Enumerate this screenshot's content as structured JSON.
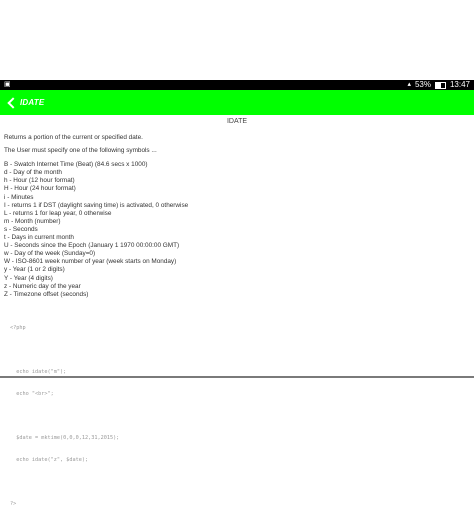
{
  "status_bar": {
    "left_icon": "image-icon",
    "battery_pct": "53%",
    "time": "13:47"
  },
  "app_bar": {
    "title": "IDATE",
    "back_icon": "back-arrow-icon",
    "accent": "#00ff00"
  },
  "page": {
    "title": "IDATE",
    "intro": "Returns a portion of the current or specified date.",
    "instruction": "The User must specify one of the following symbols ...",
    "symbols": [
      "B - Swatch Internet Time (Beat) (84.6 secs x 1000)",
      "d - Day of the month",
      "h - Hour (12 hour format)",
      "H - Hour (24 hour format)",
      "i - Minutes",
      "I - returns 1 if DST (daylight saving time) is activated, 0 otherwise",
      "L - returns 1 for leap year, 0 otherwise",
      "m - Month (number)",
      "s - Seconds",
      "t - Days in current month",
      "U - Seconds since the Epoch (January 1 1970 00:00:00 GMT)",
      "w - Day of the week (Sunday=0)",
      "W - ISO-8601 week number of year (week starts on Monday)",
      "y - Year (1 or 2 digits)",
      "Y - Year (4 digits)",
      "z - Numeric day of the year",
      "Z - Timezone offset (seconds)"
    ],
    "code": [
      "<?php",
      "",
      "  echo idate(\"m\");",
      "  echo \"<br>\";",
      "",
      "  $date = mktime(0,0,0,12,31,2015);",
      "  echo idate(\"z\", $date);",
      "",
      "?>"
    ]
  }
}
